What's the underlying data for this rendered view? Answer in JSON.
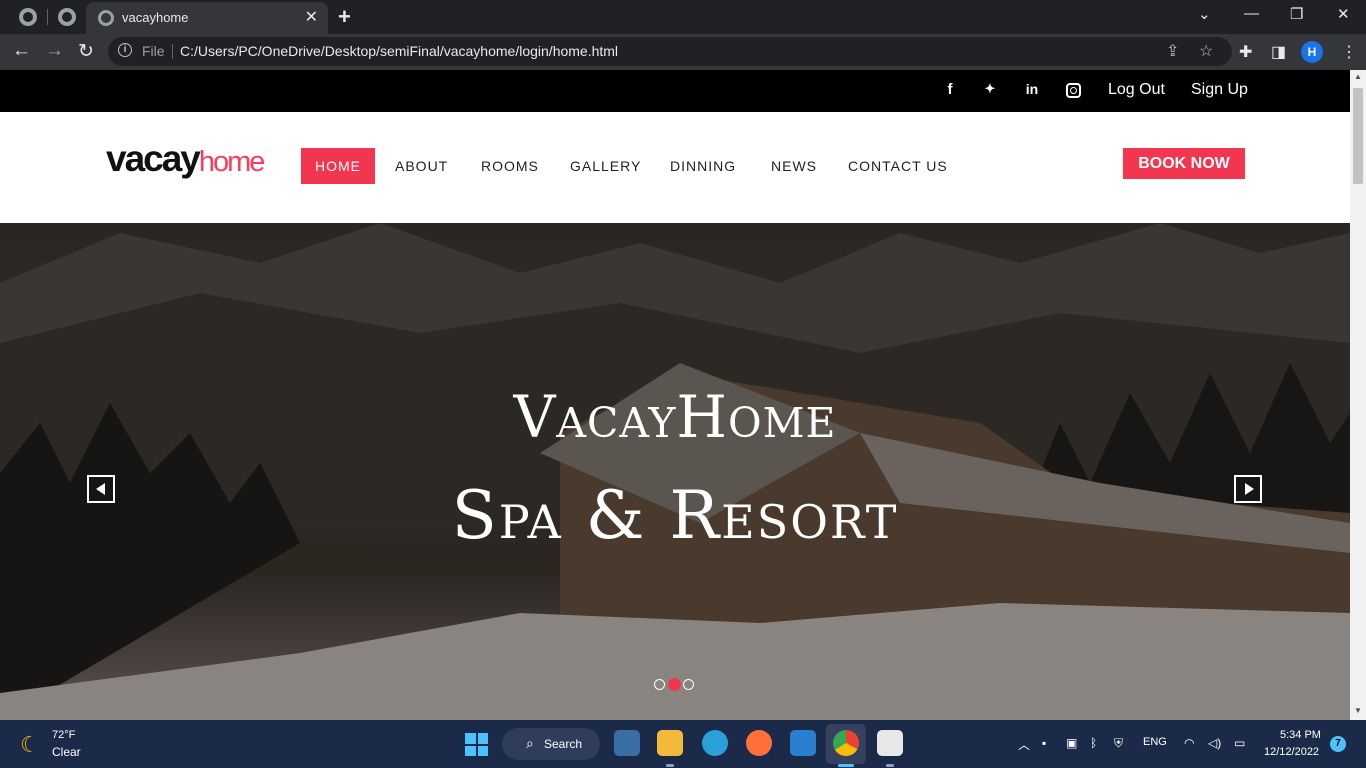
{
  "browser": {
    "tab_title": "vacayhome",
    "tab_close": "✕",
    "new_tab": "+",
    "omnibox_scheme": "File",
    "url": "C:/Users/PC/OneDrive/Desktop/semiFinal/vacayhome/login/home.html",
    "profile_initial": "H"
  },
  "site": {
    "social": {
      "facebook": "f",
      "twitter": "🐦",
      "linkedin": "in"
    },
    "logout_label": "Log Out",
    "signup_label": "Sign Up",
    "logo_main": "vacay",
    "logo_sub": "home",
    "nav": [
      "HOME",
      "ABOUT",
      "ROOMS",
      "GALLERY",
      "DINNING",
      "NEWS",
      "CONTACT US"
    ],
    "book_label": "BOOK NOW",
    "hero_line1": "VacayHome",
    "hero_line2": "Spa & Resort",
    "slide_active": 2,
    "slide_count": 3
  },
  "taskbar": {
    "temp": "72°F",
    "condition": "Clear",
    "search_label": "Search",
    "lang": "ENG",
    "time": "5:34 PM",
    "date": "12/12/2022",
    "notifications": "7"
  }
}
